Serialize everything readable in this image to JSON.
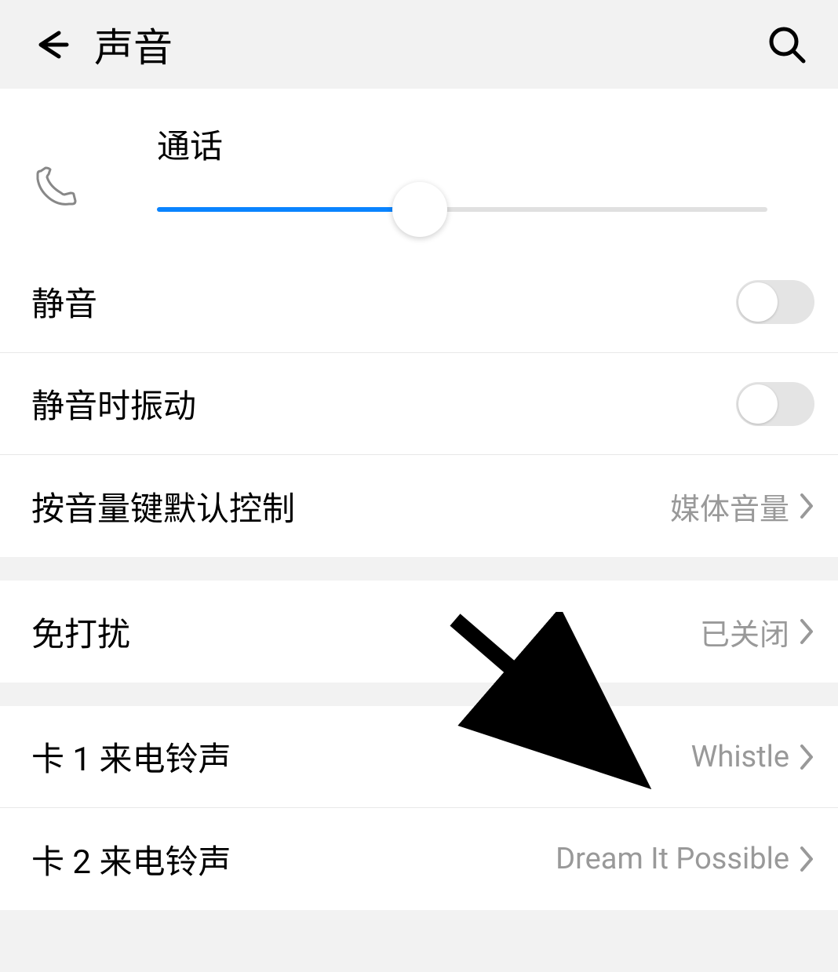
{
  "header": {
    "title": "声音"
  },
  "slider": {
    "label": "通话",
    "value": 43
  },
  "toggles": {
    "mute": {
      "label": "静音",
      "enabled": false
    },
    "vibrate_mute": {
      "label": "静音时振动",
      "enabled": false
    }
  },
  "rows": {
    "volume_key": {
      "label": "按音量键默认控制",
      "value": "媒体音量"
    },
    "dnd": {
      "label": "免打扰",
      "value": "已关闭"
    },
    "sim1_ringtone": {
      "label": "卡 1 来电铃声",
      "value": "Whistle"
    },
    "sim2_ringtone": {
      "label": "卡 2 来电铃声",
      "value": "Dream It Possible"
    }
  }
}
